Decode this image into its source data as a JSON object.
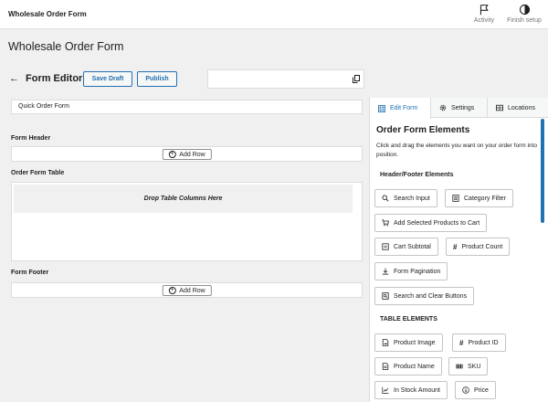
{
  "topbar": {
    "title": "Wholesale Order Form",
    "activity_label": "Activity",
    "finish_label": "Finish setup"
  },
  "page": {
    "title": "Wholesale Order Form"
  },
  "editor": {
    "title": "Form Editor",
    "save_draft_label": "Save Draft",
    "publish_label": "Publish",
    "shortcode_value": ""
  },
  "form": {
    "name_value": "Quick Order Form",
    "header_label": "Form Header",
    "table_label": "Order Form Table",
    "footer_label": "Form Footer",
    "add_row_label": "Add Row",
    "drop_label": "Drop Table Columns Here"
  },
  "sidebar": {
    "tabs": [
      {
        "label": "Edit Form",
        "icon": "table-icon",
        "active": true
      },
      {
        "label": "Settings",
        "icon": "gear-icon",
        "active": false
      },
      {
        "label": "Locations",
        "icon": "columns-icon",
        "active": false
      }
    ],
    "title": "Order Form Elements",
    "description": "Click and drag the elements you want on your order form into position.",
    "header_footer_title": "Header/Footer Elements",
    "header_footer_elements": [
      {
        "label": "Search Input",
        "icon": "search-icon"
      },
      {
        "label": "Category Filter",
        "icon": "list-icon"
      },
      {
        "label": "Add Selected Products to Cart",
        "icon": "cart-icon"
      },
      {
        "label": "Cart Subtotal",
        "icon": "receipt-icon"
      },
      {
        "label": "Product Count",
        "icon": "hash-icon"
      },
      {
        "label": "Form Pagination",
        "icon": "download-icon"
      },
      {
        "label": "Search and Clear Buttons",
        "icon": "search-clear-icon"
      }
    ],
    "table_elements_title": "TABLE ELEMENTS",
    "table_elements": [
      {
        "label": "Product Image",
        "icon": "image-icon"
      },
      {
        "label": "Product ID",
        "icon": "hash-icon"
      },
      {
        "label": "Product Name",
        "icon": "document-icon"
      },
      {
        "label": "SKU",
        "icon": "barcode-icon"
      },
      {
        "label": "In Stock Amount",
        "icon": "chart-icon"
      },
      {
        "label": "Price",
        "icon": "dollar-icon"
      }
    ]
  },
  "colors": {
    "accent": "#2271b1",
    "background": "#f0f0f1",
    "panel": "#ffffff",
    "border": "#dcdcde"
  }
}
